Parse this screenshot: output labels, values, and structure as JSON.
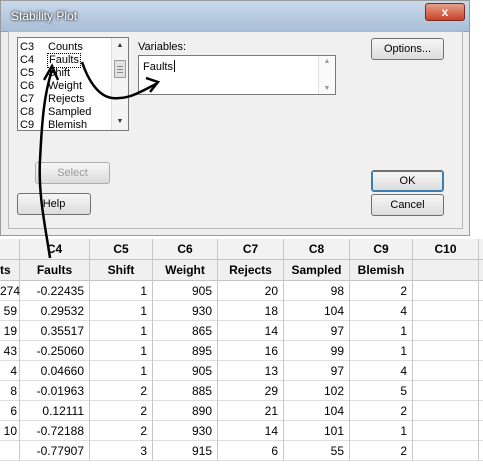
{
  "dialog": {
    "title": "Stability Plot",
    "close_label": "x",
    "columns": [
      {
        "col": "C3",
        "name": "Counts"
      },
      {
        "col": "C4",
        "name": "Faults"
      },
      {
        "col": "C5",
        "name": "Shift"
      },
      {
        "col": "C6",
        "name": "Weight"
      },
      {
        "col": "C7",
        "name": "Rejects"
      },
      {
        "col": "C8",
        "name": "Sampled"
      },
      {
        "col": "C9",
        "name": "Blemish"
      }
    ],
    "variables_label": "Variables:",
    "variables_value": "Faults",
    "buttons": {
      "options": "Options...",
      "select": "Select",
      "help": "Help",
      "ok": "OK",
      "cancel": "Cancel"
    }
  },
  "worksheet": {
    "col_ids": [
      "",
      "C4",
      "C5",
      "C6",
      "C7",
      "C8",
      "C9",
      "C10"
    ],
    "col_names": [
      "ts",
      "Faults",
      "Shift",
      "Weight",
      "Rejects",
      "Sampled",
      "Blemish",
      ""
    ],
    "rows": [
      [
        "274",
        "-0.22435",
        "1",
        "905",
        "20",
        "98",
        "2",
        ""
      ],
      [
        "59",
        "0.29532",
        "1",
        "930",
        "18",
        "104",
        "4",
        ""
      ],
      [
        "19",
        "0.35517",
        "1",
        "865",
        "14",
        "97",
        "1",
        ""
      ],
      [
        "43",
        "-0.25060",
        "1",
        "895",
        "16",
        "99",
        "1",
        ""
      ],
      [
        "4",
        "0.04660",
        "1",
        "905",
        "13",
        "97",
        "4",
        ""
      ],
      [
        "8",
        "-0.01963",
        "2",
        "885",
        "29",
        "102",
        "5",
        ""
      ],
      [
        "6",
        "0.12111",
        "2",
        "890",
        "21",
        "104",
        "2",
        ""
      ],
      [
        "10",
        "-0.72188",
        "2",
        "930",
        "14",
        "101",
        "1",
        ""
      ],
      [
        "",
        "-0.77907",
        "3",
        "915",
        "6",
        "55",
        "2",
        ""
      ]
    ]
  },
  "colors": {
    "titlebar": "#b9cde3",
    "close_button": "#c7432a",
    "annotation_arrow": "#000000"
  }
}
